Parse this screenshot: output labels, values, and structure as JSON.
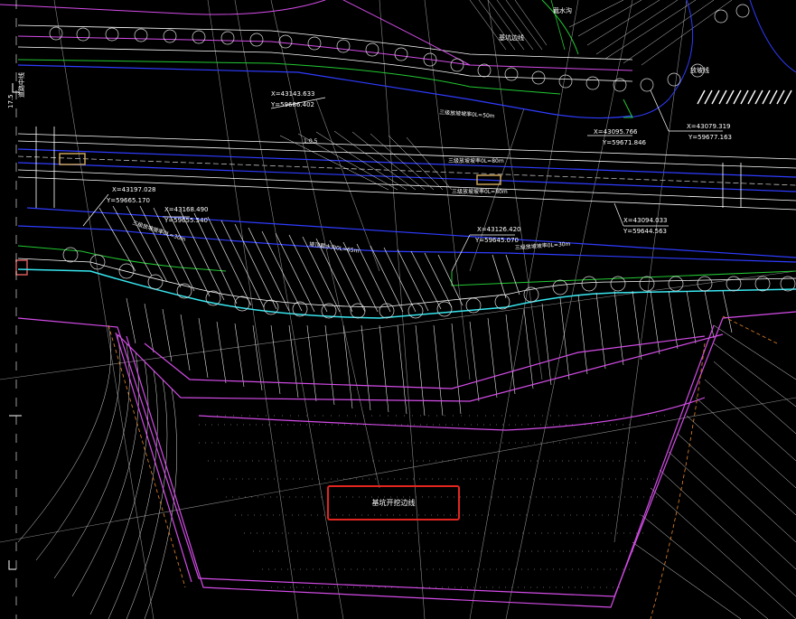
{
  "colors": {
    "background": "#000000",
    "boundary": "#d44ce8",
    "road_edge": "#2f3cff",
    "green_line": "#22c832",
    "cyan_line": "#37e6f0",
    "hatch": "#ffffff",
    "orange_dashed": "#e8862a",
    "highlight": "#e2261f",
    "tan_marker": "#c9a35a"
  },
  "labels": [
    {
      "text": "X=43143.633"
    },
    {
      "text": "Y=59686.402"
    },
    {
      "text": "三级放坡坡率0L=50m"
    },
    {
      "text": "X=43095.766"
    },
    {
      "text": "Y=59671.846"
    },
    {
      "text": "X=43079.319"
    },
    {
      "text": "Y=59677.163"
    },
    {
      "text": "X=43197.028"
    },
    {
      "text": "Y=59665.170"
    },
    {
      "text": "X=43168.490"
    },
    {
      "text": "Y=59655.540"
    },
    {
      "text": "三级放坡坡率0L=30m"
    },
    {
      "text": "X=43126.420"
    },
    {
      "text": "Y=59645.070"
    },
    {
      "text": "X=43094.033"
    },
    {
      "text": "Y=59644.563"
    },
    {
      "text": "三级放坡坡率0L=30m"
    },
    {
      "text": "坡顶截水沟0L=65m"
    },
    {
      "text": "三级放坡坡率0L=80m"
    },
    {
      "text": "三级放坡坡率0L=80m"
    },
    {
      "text": "1:0.5"
    },
    {
      "text": "基坑边线"
    },
    {
      "text": "放坡线"
    },
    {
      "text": "截水沟"
    },
    {
      "text": "17.5"
    },
    {
      "text": "道路中线"
    }
  ],
  "selection": {
    "label": "基坑开挖边线"
  }
}
